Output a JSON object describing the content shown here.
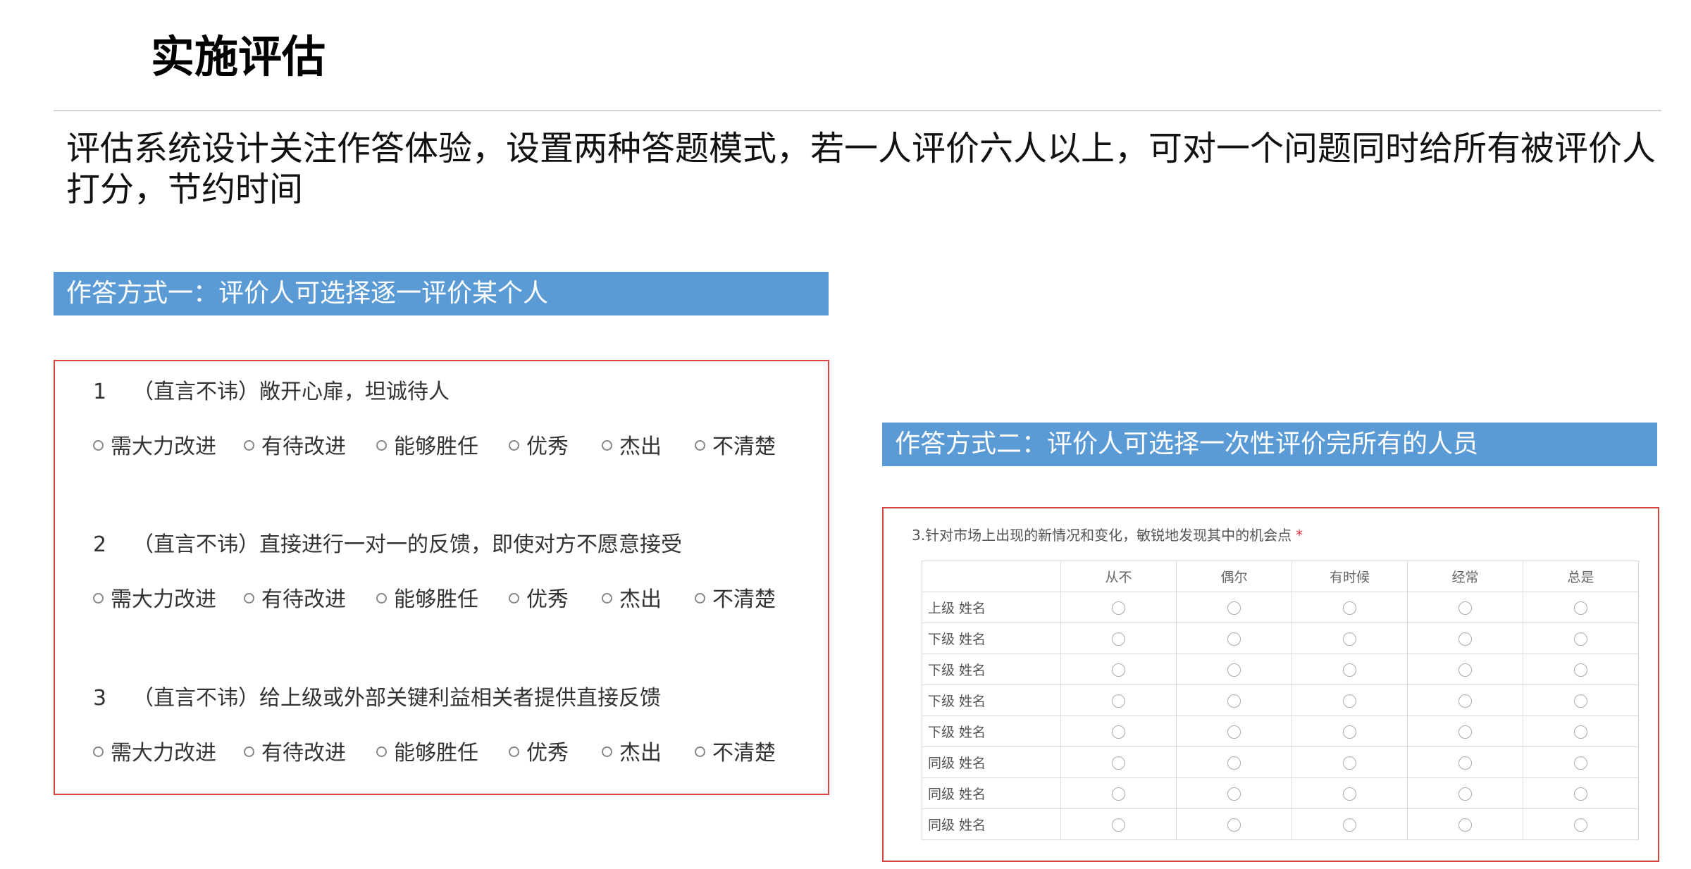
{
  "page": {
    "title": "实施评估",
    "intro": "评估系统设计关注作答体验，设置两种答题模式，若一人评价六人以上，可对一个问题同时给所有被评价人打分，节约时间"
  },
  "mode_one": {
    "banner": "作答方式一：评价人可选择逐一评价某个人",
    "options": [
      "需大力改进",
      "有待改进",
      "能够胜任",
      "优秀",
      "杰出",
      "不清楚"
    ],
    "questions": [
      {
        "num": "1",
        "text": "（直言不讳）敞开心扉，坦诚待人"
      },
      {
        "num": "2",
        "text": "（直言不讳）直接进行一对一的反馈，即使对方不愿意接受"
      },
      {
        "num": "3",
        "text": "（直言不讳）给上级或外部关键利益相关者提供直接反馈"
      }
    ]
  },
  "mode_two": {
    "banner": "作答方式二：评价人可选择一次性评价完所有的人员",
    "question": "3.针对市场上出现的新情况和变化，敏锐地发现其中的机会点",
    "required_mark": "*",
    "columns": [
      "从不",
      "偶尔",
      "有时候",
      "经常",
      "总是"
    ],
    "rows": [
      "上级 姓名",
      "下级 姓名",
      "下级 姓名",
      "下级 姓名",
      "下级 姓名",
      "同级 姓名",
      "同级 姓名",
      "同级 姓名"
    ]
  }
}
